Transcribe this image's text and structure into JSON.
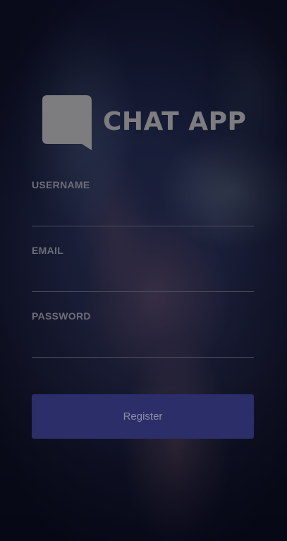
{
  "app": {
    "title": "CHAT APP"
  },
  "icons": {
    "logo": "chat-bubble-icon"
  },
  "colors": {
    "logo": "#7d7d80",
    "button_background": "#2c2e6a",
    "label": "#6c6d76"
  },
  "form": {
    "username": {
      "label": "USERNAME",
      "value": ""
    },
    "email": {
      "label": "EMAIL",
      "value": ""
    },
    "password": {
      "label": "PASSWORD",
      "value": ""
    },
    "register_label": "Register"
  }
}
